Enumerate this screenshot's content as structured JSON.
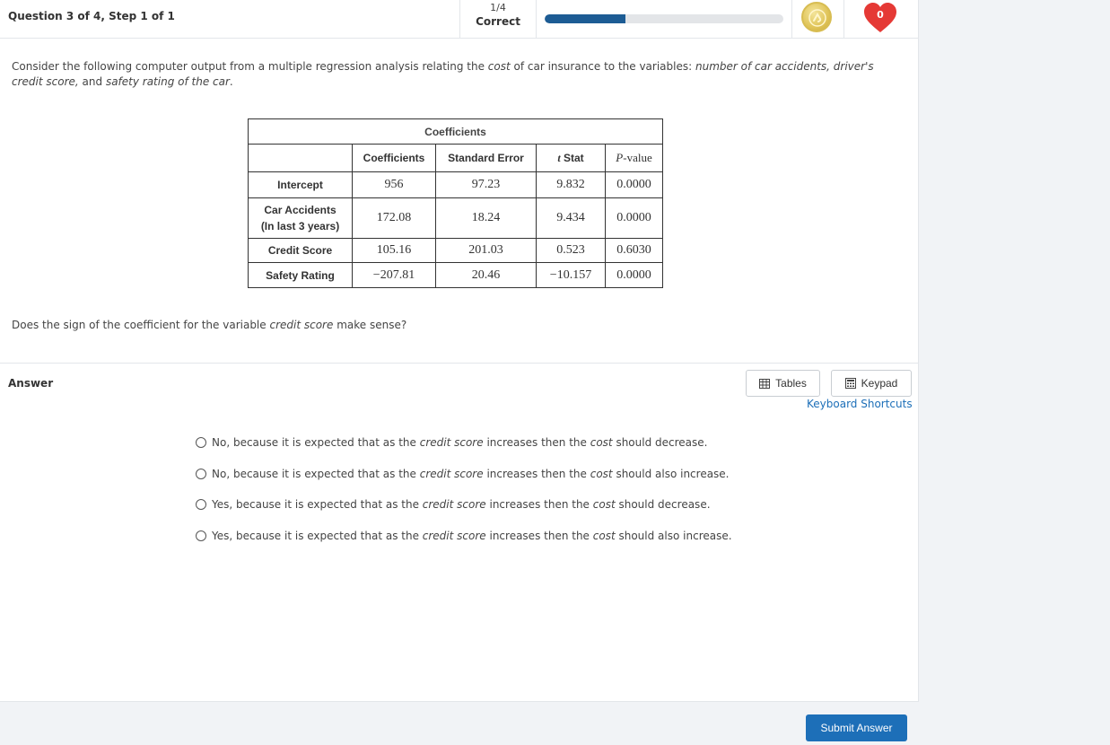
{
  "header": {
    "question_label": "Question 3 of 4, Step 1 of 1",
    "score_fraction": "1/4",
    "score_word": "Correct",
    "progress": 0.34,
    "heart_count": "0",
    "accent": "#1d5c94",
    "heart_color": "#e53935",
    "coin_color": "#e0c458"
  },
  "prompt": {
    "p1": "Consider the following computer output from a multiple regression analysis relating the ",
    "cost": "cost",
    "p2": " of car insurance to the variables: ",
    "vars": "number of car accidents, driver's credit score,",
    "p3": " and ",
    "safety": "safety rating of the car",
    "p4": "."
  },
  "table": {
    "caption": "Coefficients",
    "headers": {
      "coefficients": "Coefficients",
      "std_error": "Standard Error",
      "t_italic": "t",
      "t_stat": " Stat",
      "p_italic": "P",
      "p_value": "-value"
    },
    "rows": [
      {
        "label": "Intercept",
        "coef": "956",
        "se": "97.23",
        "t": "9.832",
        "p": "0.0000"
      },
      {
        "label_line1": "Car Accidents",
        "label_line2": "(In last 3 years)",
        "coef": "172.08",
        "se": "18.24",
        "t": "9.434",
        "p": "0.0000"
      },
      {
        "label": "Credit Score",
        "coef": "105.16",
        "se": "201.03",
        "t": "0.523",
        "p": "0.6030"
      },
      {
        "label": "Safety Rating",
        "coef": "−207.81",
        "se": "20.46",
        "t": "−10.157",
        "p": "0.0000"
      }
    ]
  },
  "question": {
    "q1": "Does the sign of the coefficient for the variable ",
    "var": "credit score",
    "q2": " make sense?"
  },
  "answer": {
    "label": "Answer",
    "tables_label": "Tables",
    "keypad_label": "Keypad",
    "shortcuts_label": "Keyboard Shortcuts",
    "options": [
      {
        "a": "No, because it is expected that as the ",
        "b": "credit score",
        "c": " increases then the ",
        "d": "cost",
        "e": " should decrease."
      },
      {
        "a": "No, because it is expected that as the ",
        "b": "credit score",
        "c": " increases then the ",
        "d": "cost",
        "e": " should also increase."
      },
      {
        "a": "Yes, because it is expected that as the ",
        "b": "credit score",
        "c": " increases then the ",
        "d": "cost",
        "e": " should decrease."
      },
      {
        "a": "Yes, because it is expected that as the ",
        "b": "credit score",
        "c": " increases then the ",
        "d": "cost",
        "e": " should also increase."
      }
    ]
  },
  "footer": {
    "submit_label": "Submit Answer"
  }
}
